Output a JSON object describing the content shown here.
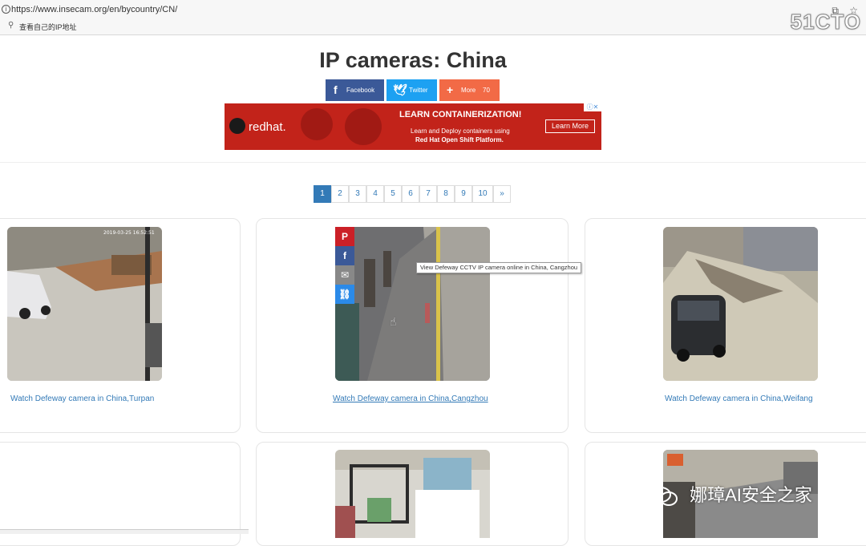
{
  "browser": {
    "info_icon": "i",
    "url": "https://www.insecam.org/en/bycountry/CN/",
    "bookmark_label": "查看自己的IP地址",
    "brand": "51CTO"
  },
  "page": {
    "title": "IP cameras: China"
  },
  "share": {
    "facebook": "Facebook",
    "twitter": "Twitter",
    "more": "More",
    "more_count": "70"
  },
  "ad": {
    "brand": "redhat.",
    "headline": "LEARN CONTAINERIZATION!",
    "line1": "Learn and Deploy containers using",
    "line2": "Red Hat Open Shift Platform.",
    "cta": "Learn More"
  },
  "pagination": {
    "pages": [
      "1",
      "2",
      "3",
      "4",
      "5",
      "6",
      "7",
      "8",
      "9",
      "10",
      "»"
    ],
    "active": "1"
  },
  "cameras": [
    {
      "link": "Watch Defeway camera in China,Turpan",
      "timestamp": "2019-03-25 16:52:51"
    },
    {
      "link": "Watch Defeway camera in China,Cangzhou"
    },
    {
      "link": "Watch Defeway camera in China,Weifang"
    }
  ],
  "tooltip": "View Defeway CCTV IP camera online in China, Cangzhou",
  "watermark": "娜璋AI安全之家",
  "colors": {
    "facebook": "#3b5998",
    "twitter": "#1da1f2",
    "more": "#f26a46",
    "link": "#337ab7",
    "ad_red": "#c2231a",
    "pinterest": "#cb2027",
    "email": "#888888",
    "copylink": "#2b8ae8"
  }
}
